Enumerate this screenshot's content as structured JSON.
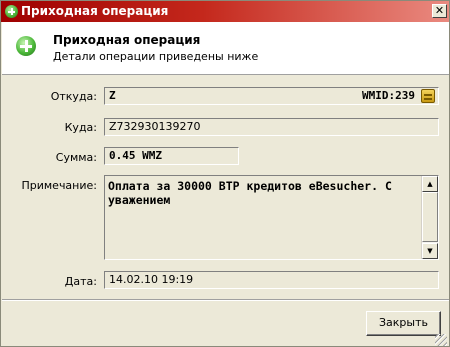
{
  "window": {
    "title": "Приходная операция",
    "close_label": "✕"
  },
  "header": {
    "title": "Приходная операция",
    "subtitle": "Детали операции приведены ниже"
  },
  "form": {
    "from": {
      "label": "Откуда:",
      "value": "Z",
      "wmid": "WMID:239"
    },
    "to": {
      "label": "Куда:",
      "value": "Z732930139270"
    },
    "amount": {
      "label": "Сумма:",
      "value": "0.45 WMZ"
    },
    "note": {
      "label": "Примечание:",
      "value": "Оплата за 30000 ВТР кредитов eBesucher. С уважением"
    },
    "date": {
      "label": "Дата:",
      "value": "14.02.10 19:19"
    }
  },
  "buttons": {
    "close": "Закрыть"
  },
  "icons": {
    "title": "add-icon",
    "header": "add-icon",
    "wallet": "wallet-icon"
  }
}
